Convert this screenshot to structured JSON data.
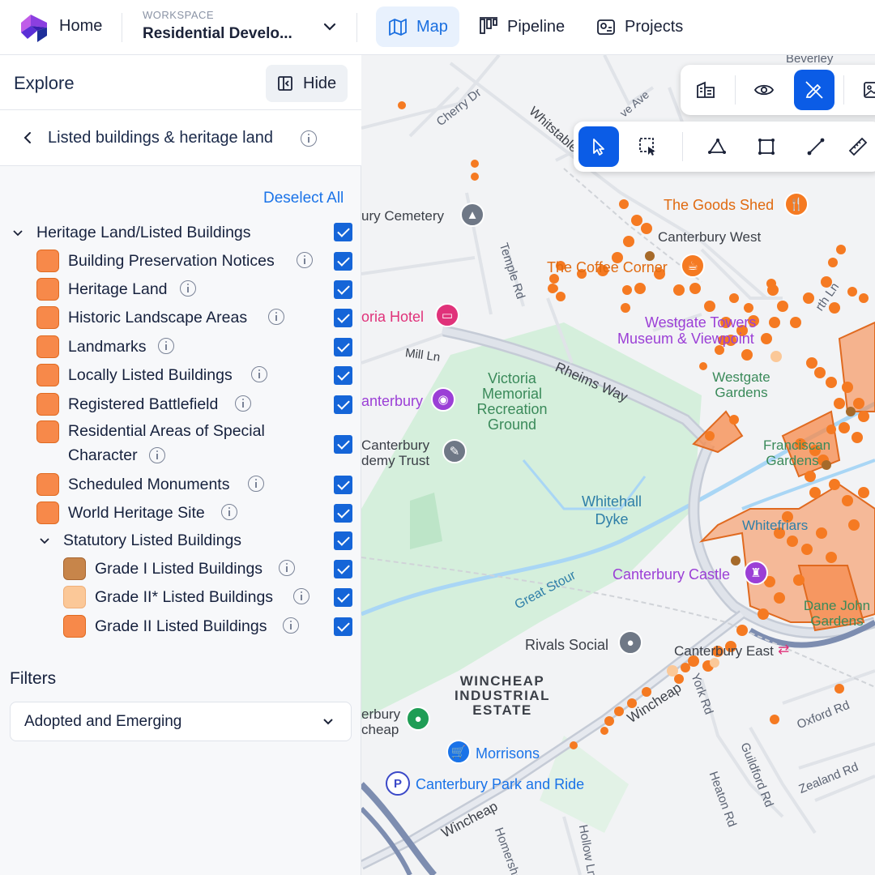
{
  "header": {
    "home_label": "Home",
    "workspace_caption": "WORKSPACE",
    "workspace_name": "Residential Develo...",
    "tabs": [
      {
        "label": "Map",
        "active": true,
        "icon": "map-icon"
      },
      {
        "label": "Pipeline",
        "active": false,
        "icon": "pipeline-icon"
      },
      {
        "label": "Projects",
        "active": false,
        "icon": "projects-icon"
      }
    ]
  },
  "sidebar": {
    "title": "Explore",
    "hide_label": "Hide",
    "layer_group_title": "Listed buildings & heritage land",
    "deselect_all": "Deselect All",
    "parent_layer": "Heritage Land/Listed Buildings",
    "layers": [
      {
        "label": "Building Preservation Notices",
        "color": "#f7894a"
      },
      {
        "label": "Heritage Land",
        "color": "#f7894a"
      },
      {
        "label": "Historic Landscape Areas",
        "color": "#f7894a"
      },
      {
        "label": "Landmarks",
        "color": "#f7894a"
      },
      {
        "label": "Locally Listed Buildings",
        "color": "#f7894a"
      },
      {
        "label": "Registered Battlefield",
        "color": "#f7894a"
      },
      {
        "label_line1": "Residential Areas of Special",
        "label_line2": "Character",
        "color": "#f7894a"
      },
      {
        "label": "Scheduled Monuments",
        "color": "#f7894a"
      },
      {
        "label": "World Heritage Site",
        "color": "#f7894a"
      }
    ],
    "sub_group": "Statutory Listed Buildings",
    "sub_layers": [
      {
        "label": "Grade I Listed Buildings",
        "color": "#c7854a"
      },
      {
        "label": "Grade II* Listed Buildings",
        "color": "#fbc898"
      },
      {
        "label": "Grade II Listed Buildings",
        "color": "#f7894a"
      }
    ],
    "filters_title": "Filters",
    "filters_value": "Adopted and Emerging"
  },
  "map": {
    "streets": [
      "Cherry Dr",
      "Whitstable Rd",
      "Temple Rd",
      "Mill Ln",
      "Rheims Way",
      "Great Stour",
      "Wincheap",
      "York Rd",
      "Guildford Rd",
      "Heaton Rd",
      "Oxford Rd",
      "Zealand Rd",
      "Hollow Ln",
      "Homersham",
      "Beverley",
      "ve Ave",
      "rth Ln"
    ],
    "places": [
      {
        "label": "The Goods Shed",
        "color": "#e06a10"
      },
      {
        "label": "Canterbury West",
        "color": "#3b3f47"
      },
      {
        "label": "The Coffee Corner",
        "color": "#e06a10"
      },
      {
        "label": "Westgate Towers",
        "color": "#9b3fd6"
      },
      {
        "label": "Museum & Viewpoint",
        "color": "#9b3fd6"
      },
      {
        "label": "oria Hotel",
        "color": "#e0327a"
      },
      {
        "label": "ury Cemetery",
        "color": "#3b3f47"
      },
      {
        "label": "anterbury",
        "color": "#9b3fd6"
      },
      {
        "label": "Victoria Memorial Recreation Ground",
        "color": "#3a8a5a"
      },
      {
        "label": "Westgate Gardens",
        "color": "#3a8a5a"
      },
      {
        "label": "Franciscan Gardens",
        "color": "#3a8a5a"
      },
      {
        "label": "Canterbury demy Trust",
        "color": "#3b3f47"
      },
      {
        "label": "Whitehall Dyke",
        "color": "#2f7fa8"
      },
      {
        "label": "Whitefriars",
        "color": "#2f7fa8"
      },
      {
        "label": "Canterbury Castle",
        "color": "#9b3fd6"
      },
      {
        "label": "Dane John Gardens",
        "color": "#3a8a5a"
      },
      {
        "label": "Rivals Social",
        "color": "#3b3f47"
      },
      {
        "label": "Canterbury East",
        "color": "#3b3f47"
      },
      {
        "label": "WINCHEAP INDUSTRIAL ESTATE",
        "color": "#3b3f47"
      },
      {
        "label": "erbury cheap",
        "color": "#3b3f47"
      },
      {
        "label": "Morrisons",
        "color": "#1a73e8"
      },
      {
        "label": "Canterbury Park and Ride",
        "color": "#1a73e8"
      }
    ],
    "toolbar_top": [
      "buildings-icon",
      "eye-icon",
      "no-draw-icon",
      "image-icon"
    ],
    "toolbar_draw": [
      "pointer-icon",
      "select-area-icon",
      "polygon-icon",
      "rectangle-icon",
      "line-icon",
      "ruler-icon"
    ]
  }
}
